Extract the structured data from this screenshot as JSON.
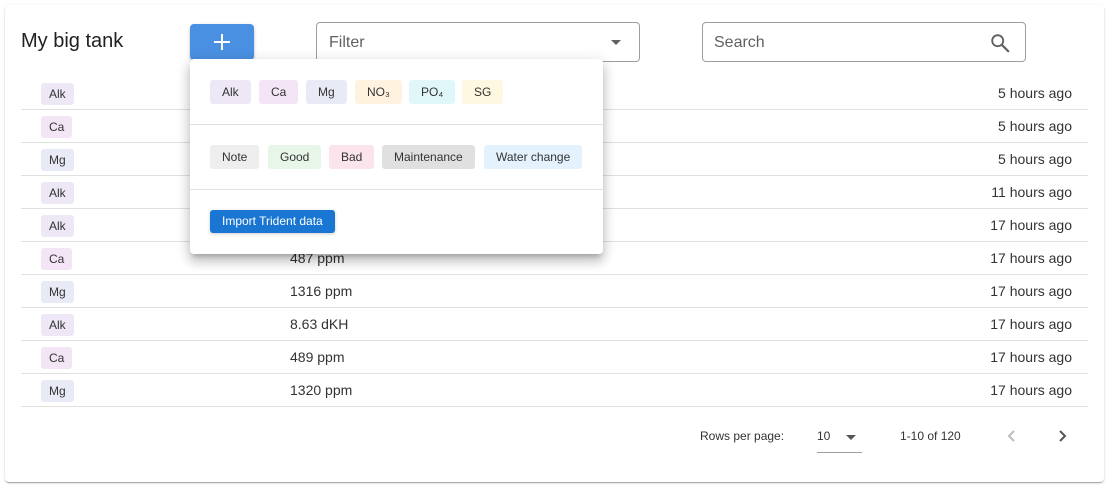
{
  "header": {
    "title": "My big tank",
    "add_button_icon": "plus-icon",
    "filter": {
      "placeholder": "Filter"
    },
    "search": {
      "placeholder": "Search",
      "icon": "search-icon"
    }
  },
  "colors": {
    "Alk": "#ede7f6",
    "Ca": "#f3e5f5",
    "Mg": "#e8eaf6",
    "NO₃": "#fff3e0",
    "PO₄": "#e0f7fa",
    "SG": "#fff8e1",
    "Note": "#eeeeee",
    "Good": "#e8f5e9",
    "Bad": "#fce4ec",
    "Maintenance": "#e0e0e0",
    "Water change": "#e3f2fd",
    "accent": "#4a90e2",
    "button": "#1976d2"
  },
  "rows": [
    {
      "type": "Alk",
      "value": "",
      "time": "5 hours ago"
    },
    {
      "type": "Ca",
      "value": "",
      "time": "5 hours ago"
    },
    {
      "type": "Mg",
      "value": "",
      "time": "5 hours ago"
    },
    {
      "type": "Alk",
      "value": "",
      "time": "11 hours ago"
    },
    {
      "type": "Alk",
      "value": "",
      "time": "17 hours ago"
    },
    {
      "type": "Ca",
      "value": "487 ppm",
      "time": "17 hours ago"
    },
    {
      "type": "Mg",
      "value": "1316 ppm",
      "time": "17 hours ago"
    },
    {
      "type": "Alk",
      "value": "8.63 dKH",
      "time": "17 hours ago"
    },
    {
      "type": "Ca",
      "value": "489 ppm",
      "time": "17 hours ago"
    },
    {
      "type": "Mg",
      "value": "1320 ppm",
      "time": "17 hours ago"
    }
  ],
  "pagination": {
    "rows_per_page_label": "Rows per page:",
    "rows_per_page": "10",
    "range": "1-10 of 120",
    "prev_icon": "chevron-left-icon",
    "next_icon": "chevron-right-icon"
  },
  "add_menu": {
    "parameters": [
      "Alk",
      "Ca",
      "Mg",
      "NO₃",
      "PO₄",
      "SG"
    ],
    "events": [
      "Note",
      "Good",
      "Bad",
      "Maintenance",
      "Water change"
    ],
    "import_label": "Import Trident data"
  }
}
